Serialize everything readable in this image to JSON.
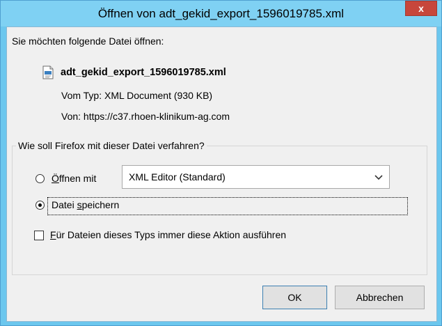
{
  "dialog": {
    "title": "Öffnen von adt_gekid_export_1596019785.xml",
    "close_label": "x",
    "prompt": "Sie möchten folgende Datei öffnen:",
    "file": {
      "name": "adt_gekid_export_1596019785.xml",
      "type_line": "Vom Typ: XML Document (930 KB)",
      "from_line": "Von: https://c37.rhoen-klinikum-ag.com"
    },
    "group": {
      "legend": "Wie soll Firefox mit dieser Datei verfahren?",
      "open_with": {
        "label_prefix": "",
        "label_underlined": "Ö",
        "label_rest": "ffnen mit",
        "selected": false,
        "app_value": "XML Editor (Standard)"
      },
      "save_file": {
        "label_prefix": "Datei ",
        "label_underlined": "s",
        "label_rest": "peichern",
        "selected": true
      },
      "always": {
        "label_underlined": "F",
        "label_rest": "ür Dateien dieses Typs immer diese Aktion ausführen",
        "checked": false
      }
    },
    "buttons": {
      "ok": "OK",
      "cancel": "Abbrechen"
    }
  },
  "colors": {
    "frame": "#6cc7ee",
    "titlebar": "#7fd1f3",
    "close": "#c7463b",
    "client": "#f0f0f0"
  }
}
